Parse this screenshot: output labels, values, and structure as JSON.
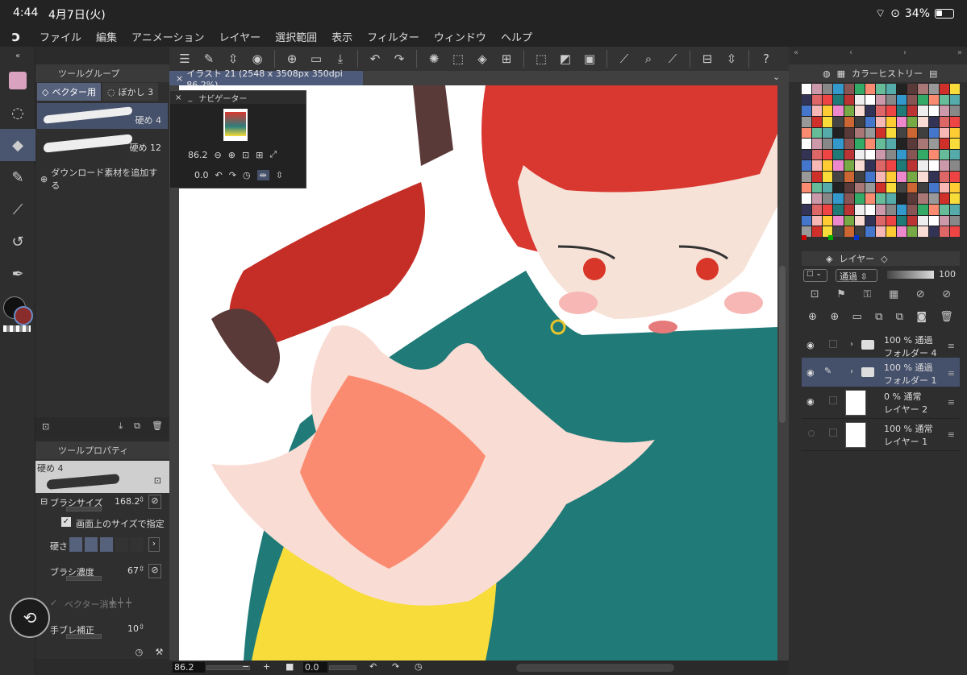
{
  "status": {
    "time": "4:44",
    "date": "4月7日(火)",
    "battery": "34%"
  },
  "menu": [
    "ファイル",
    "編集",
    "アニメーション",
    "レイヤー",
    "選択範囲",
    "表示",
    "フィルター",
    "ウィンドウ",
    "ヘルプ"
  ],
  "toolgroup": {
    "title": "ツールグループ",
    "tabs": [
      "ベクター用",
      "ぼかし 3"
    ],
    "brushes": [
      "硬め 4",
      "硬め 12"
    ],
    "add_material": "ダウンロード素材を追加する"
  },
  "doc": {
    "tab": "イラスト 21 (2548 x 3508px 350dpi 86.2%)"
  },
  "navigator": {
    "title": "ナビゲーター",
    "zoom": "86.2",
    "angle": "0.0"
  },
  "toolprop": {
    "title": "ツールプロパティ",
    "brush_name": "硬め 4",
    "brush_size_label": "ブラシサイズ",
    "brush_size": "168.2",
    "screen_size": "画面上のサイズで指定",
    "hardness_label": "硬さ",
    "density_label": "ブラシ濃度",
    "density": "67",
    "vector_erase": "ベクター消去",
    "stabilization_label": "手ブレ補正",
    "stabilization": "10"
  },
  "bottom": {
    "zoom": "86.2",
    "angle": "0.0"
  },
  "color_history": {
    "title": "カラーヒストリー"
  },
  "layers": {
    "title": "レイヤー",
    "blend": "通過",
    "opacity": "100",
    "items": [
      {
        "l1": "100 % 通過",
        "l2": "フォルダー 4",
        "type": "folder"
      },
      {
        "l1": "100 % 通過",
        "l2": "フォルダー 1",
        "type": "folder"
      },
      {
        "l1": "0 % 通常",
        "l2": "レイヤー 2",
        "type": "layer"
      },
      {
        "l1": "100 % 通常",
        "l2": "レイヤー 1",
        "type": "layer"
      }
    ]
  }
}
